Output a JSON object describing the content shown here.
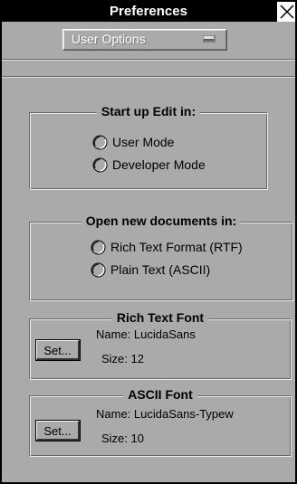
{
  "window": {
    "title": "Preferences",
    "close_icon": "close-icon"
  },
  "options_menu": {
    "selected": "User Options",
    "arrow_icon": "popup-menu-icon"
  },
  "startup_group": {
    "title": "Start up Edit in:",
    "options": [
      {
        "label": "User Mode",
        "selected": false
      },
      {
        "label": "Developer Mode",
        "selected": false
      }
    ]
  },
  "open_docs_group": {
    "title": "Open new documents in:",
    "options": [
      {
        "label": "Rich Text Format (RTF)",
        "selected": false
      },
      {
        "label": "Plain Text (ASCII)",
        "selected": false
      }
    ]
  },
  "rich_text_font": {
    "title": "Rich Text Font",
    "button": "Set...",
    "name_label": "Name:",
    "name_value": "LucidaSans",
    "size_label": "Size:",
    "size_value": "12"
  },
  "ascii_font": {
    "title": "ASCII Font",
    "button": "Set...",
    "name_label": "Name:",
    "name_value": "LucidaSans-Typew",
    "size_label": "Size:",
    "size_value": "10"
  }
}
